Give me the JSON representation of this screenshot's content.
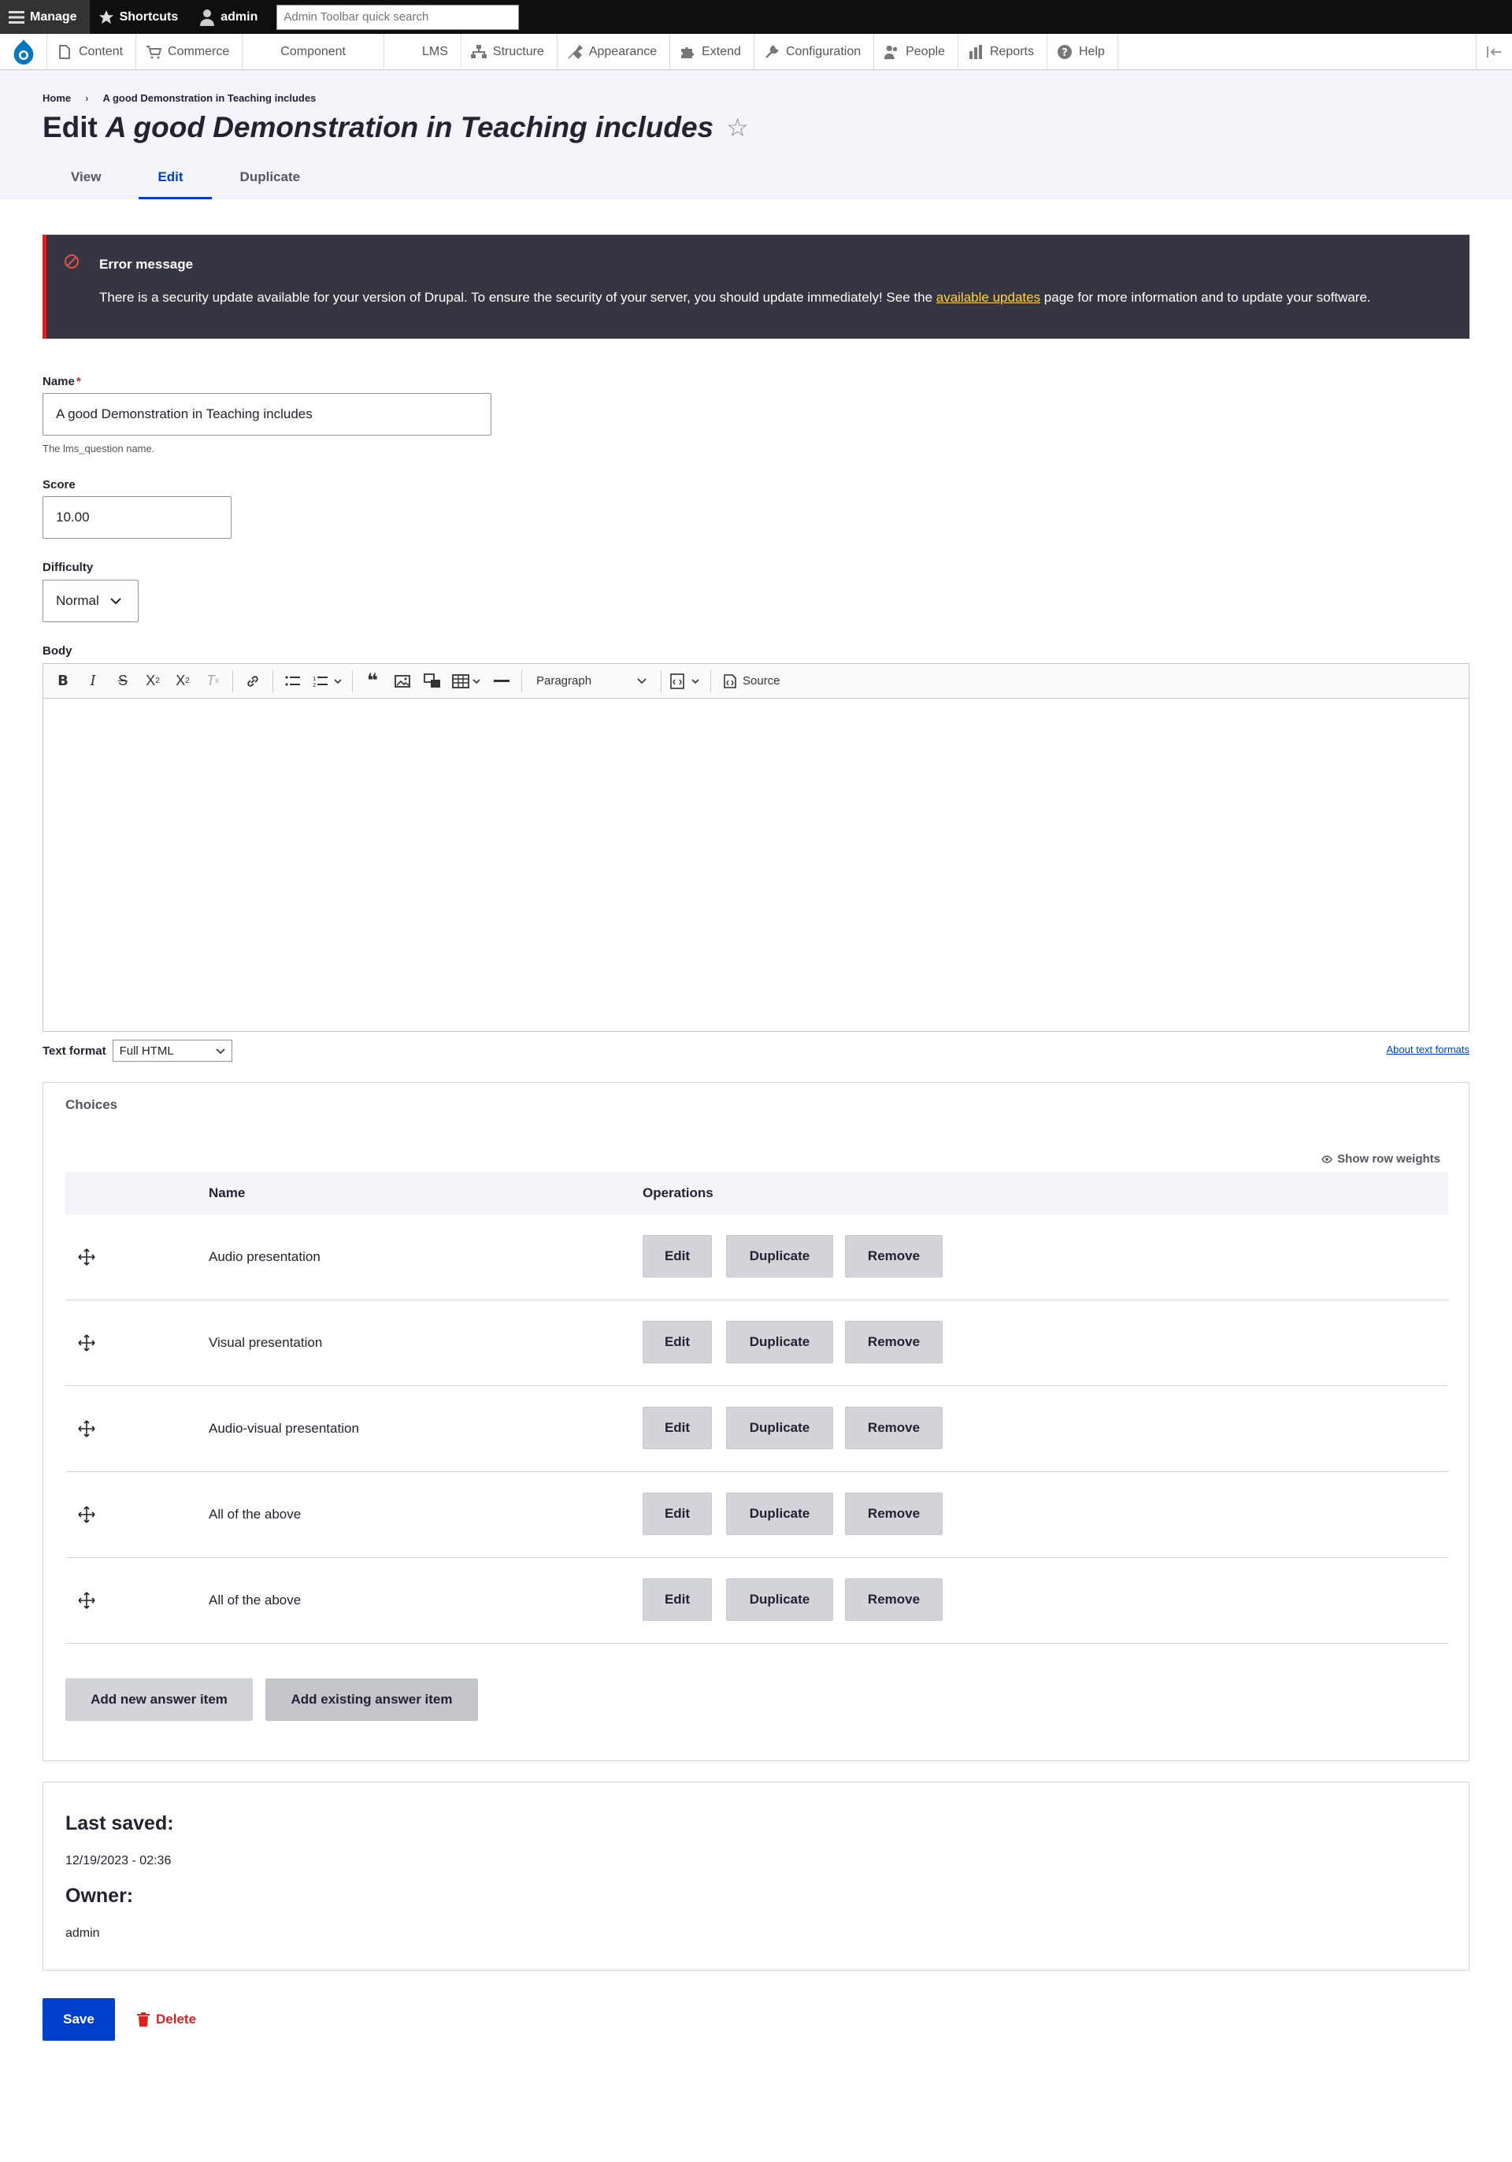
{
  "admin_toolbar": {
    "manage": "Manage",
    "shortcuts": "Shortcuts",
    "user": "admin",
    "search_placeholder": "Admin Toolbar quick search"
  },
  "menu": {
    "items": [
      {
        "label": "Content",
        "icon": "document-icon"
      },
      {
        "label": "Commerce",
        "icon": "cart-icon"
      },
      {
        "label": "Component",
        "icon": ""
      },
      {
        "label": "LMS",
        "icon": ""
      },
      {
        "label": "Structure",
        "icon": "sitemap-icon"
      },
      {
        "label": "Appearance",
        "icon": "brush-icon"
      },
      {
        "label": "Extend",
        "icon": "puzzle-icon"
      },
      {
        "label": "Configuration",
        "icon": "wrench-icon"
      },
      {
        "label": "People",
        "icon": "people-icon"
      },
      {
        "label": "Reports",
        "icon": "bar-chart-icon"
      },
      {
        "label": "Help",
        "icon": "help-icon"
      }
    ]
  },
  "header": {
    "breadcrumb": [
      "Home",
      "A good Demonstration in Teaching includes"
    ],
    "title_prefix": "Edit",
    "title_entity": "A good Demonstration in Teaching includes",
    "tabs": [
      "View",
      "Edit",
      "Duplicate"
    ],
    "active_tab": "Edit"
  },
  "error": {
    "title": "Error message",
    "text_before": "There is a security update available for your version of Drupal. To ensure the security of your server, you should update immediately! See the ",
    "link": "available updates",
    "text_after": " page for more information and to update your software."
  },
  "form": {
    "name_label": "Name",
    "name_value": "A good Demonstration in Teaching includes",
    "name_desc": "The lms_question name.",
    "score_label": "Score",
    "score_value": "10.00",
    "difficulty_label": "Difficulty",
    "difficulty_value": "Normal",
    "body_label": "Body",
    "paragraph": "Paragraph",
    "source": "Source",
    "text_format_label": "Text format",
    "text_format_value": "Full HTML",
    "about_formats": "About text formats"
  },
  "choices": {
    "title": "Choices",
    "show_row_weights": "Show row weights",
    "col_name": "Name",
    "col_ops": "Operations",
    "rows": [
      {
        "name": "Audio presentation"
      },
      {
        "name": "Visual presentation"
      },
      {
        "name": "Audio-visual presentation"
      },
      {
        "name": "All of the above"
      },
      {
        "name": "All of the above"
      }
    ],
    "btn_edit": "Edit",
    "btn_duplicate": "Duplicate",
    "btn_remove": "Remove",
    "add_new": "Add new answer item",
    "add_existing": "Add existing answer item"
  },
  "meta": {
    "last_saved_label": "Last saved:",
    "last_saved_value": "12/19/2023 - 02:36",
    "owner_label": "Owner:",
    "owner_value": "admin"
  },
  "actions": {
    "save": "Save",
    "delete": "Delete"
  },
  "colors": {
    "accent": "#003ecc",
    "error_bg": "#353641",
    "danger": "#d72222",
    "link_warning": "#ffd23f"
  }
}
